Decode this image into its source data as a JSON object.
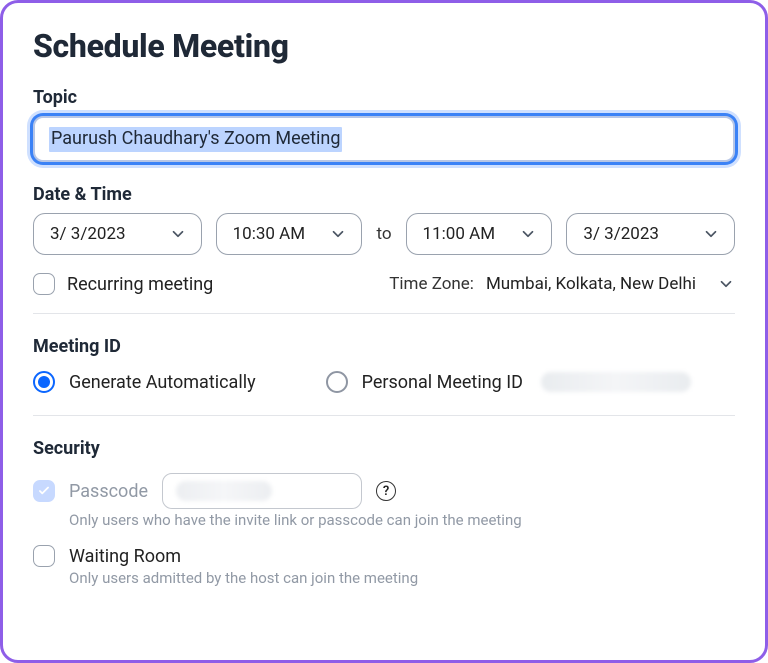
{
  "title": "Schedule Meeting",
  "topic": {
    "label": "Topic",
    "value": "Paurush Chaudhary's Zoom Meeting"
  },
  "datetime": {
    "label": "Date & Time",
    "start_date": "3/ 3/2023",
    "start_time": "10:30 AM",
    "to_label": "to",
    "end_time": "11:00 AM",
    "end_date": "3/ 3/2023"
  },
  "recurring": {
    "label": "Recurring meeting",
    "checked": false
  },
  "timezone": {
    "label": "Time Zone:",
    "value": "Mumbai, Kolkata, New Delhi"
  },
  "meeting_id": {
    "label": "Meeting ID",
    "options": {
      "auto": "Generate Automatically",
      "personal": "Personal Meeting ID"
    },
    "selected": "auto"
  },
  "security": {
    "label": "Security",
    "passcode": {
      "label": "Passcode",
      "hint": "Only users who have the invite link or passcode can join the meeting"
    },
    "waiting_room": {
      "label": "Waiting Room",
      "hint": "Only users admitted by the host can join the meeting",
      "checked": false
    }
  }
}
